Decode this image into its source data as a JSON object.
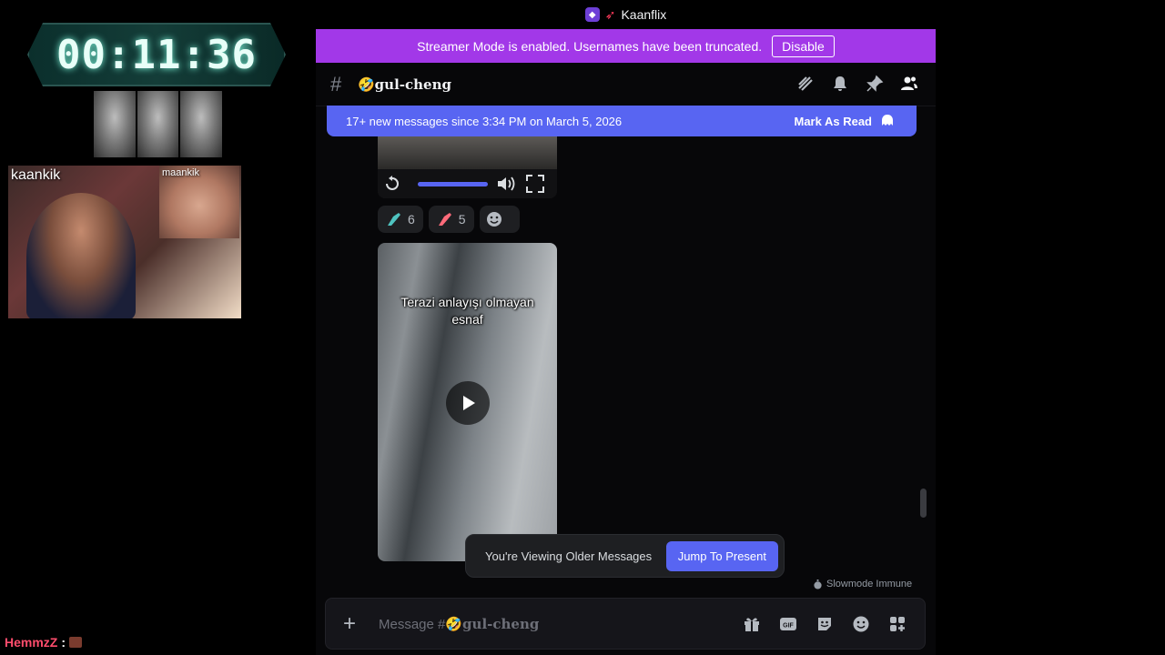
{
  "stream_overlay": {
    "timer": "00:11:36",
    "webcam_label": "kaankik",
    "webcam2_label": "maankik",
    "chat_username": "HemmzZ",
    "chat_separator": ":"
  },
  "window": {
    "server_title": "Kaanflix"
  },
  "streamer_banner": {
    "text": "Streamer Mode is enabled. Usernames have been truncated.",
    "button_label": "Disable"
  },
  "channel": {
    "hash": "#",
    "name": "🤣gul-cheng"
  },
  "new_messages_bar": {
    "text": "17+ new messages since 3:34 PM on March 5, 2026",
    "mark_read_label": "Mark As Read"
  },
  "reactions": [
    {
      "emoji": "hand-teal",
      "count": "6"
    },
    {
      "emoji": "hand-red",
      "count": "5"
    }
  ],
  "video2": {
    "caption_line1": "Terazi anlayışı olmayan",
    "caption_line2": "esnaf"
  },
  "older_messages_toast": {
    "text": "You're Viewing Older Messages",
    "button_label": "Jump To Present"
  },
  "slowmode": "Slowmode Immune",
  "composer": {
    "placeholder_prefix": "Message #",
    "channel_name": "🤣gul-cheng",
    "icons": [
      "gift-icon",
      "gif-icon",
      "sticker-icon",
      "emoji-icon",
      "apps-icon"
    ]
  },
  "colors": {
    "banner": "#a238e8",
    "blurple": "#5865f2",
    "background": "#070709"
  }
}
